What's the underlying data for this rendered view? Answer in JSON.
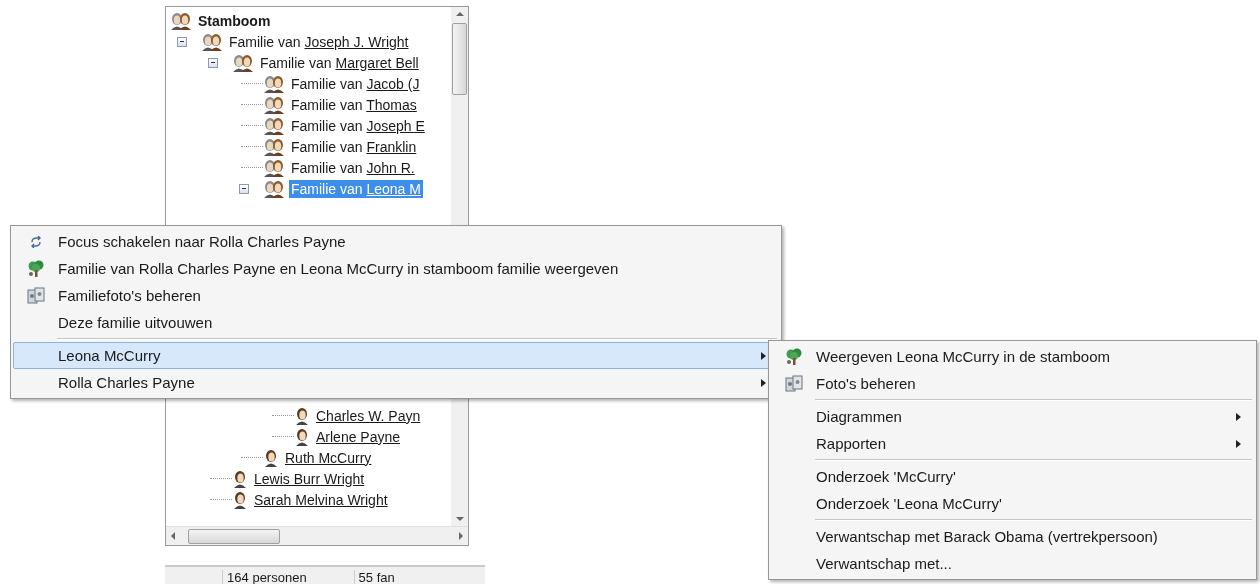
{
  "tree": {
    "nodes": [
      {
        "kind": "root",
        "label": "Stamboom",
        "selected": false,
        "children": [
          {
            "kind": "family",
            "prefix": "Familie van ",
            "name": "Joseph J. Wright",
            "selected": false,
            "children": [
              {
                "kind": "family",
                "prefix": "Familie van ",
                "name": "Margaret Bell",
                "selected": false,
                "children": [
                  {
                    "kind": "family",
                    "prefix": "Familie van ",
                    "name": "Jacob (J",
                    "selected": false
                  },
                  {
                    "kind": "family",
                    "prefix": "Familie van ",
                    "name": "Thomas",
                    "selected": false
                  },
                  {
                    "kind": "family",
                    "prefix": "Familie van ",
                    "name": "Joseph E",
                    "selected": false
                  },
                  {
                    "kind": "family",
                    "prefix": "Familie van ",
                    "name": "Franklin",
                    "selected": false
                  },
                  {
                    "kind": "family",
                    "prefix": "Familie van ",
                    "name": "John R.",
                    "selected": false
                  },
                  {
                    "kind": "family",
                    "prefix": "Familie van ",
                    "name": "Leona M",
                    "selected": true,
                    "children": [
                      {
                        "kind": "person",
                        "name": "Charles W. Payn",
                        "selected": false
                      },
                      {
                        "kind": "person",
                        "name": "Arlene Payne",
                        "selected": false
                      }
                    ]
                  },
                  {
                    "kind": "person",
                    "name": "Ruth McCurry",
                    "selected": false
                  }
                ]
              },
              {
                "kind": "person",
                "name": "Lewis Burr Wright",
                "selected": false
              },
              {
                "kind": "person",
                "name": "Sarah Melvina Wright",
                "selected": false
              }
            ]
          }
        ]
      }
    ]
  },
  "status_bar": [
    "164 personen",
    "55 fan"
  ],
  "context_menu": {
    "groups": [
      [
        {
          "kind": "switch",
          "label": "Focus schakelen naar Rolla Charles Payne",
          "selected": false,
          "submenu": false
        },
        {
          "kind": "tree",
          "label": "Familie van Rolla Charles Payne en Leona McCurry in stamboom familie weergeven",
          "selected": false,
          "submenu": false
        },
        {
          "kind": "photos",
          "label": "Familiefoto's beheren",
          "selected": false,
          "submenu": false
        },
        {
          "kind": "plain",
          "label": "Deze familie uitvouwen",
          "selected": false,
          "submenu": false
        }
      ],
      [
        {
          "kind": "plain",
          "label": "Leona McCurry",
          "selected": true,
          "submenu": true
        },
        {
          "kind": "plain",
          "label": "Rolla Charles Payne",
          "selected": false,
          "submenu": true
        }
      ]
    ]
  },
  "submenu": {
    "groups": [
      [
        {
          "kind": "tree",
          "label": "Weergeven Leona McCurry in de stamboom",
          "selected": false,
          "submenu": false
        },
        {
          "kind": "photos",
          "label": "Foto's beheren",
          "selected": false,
          "submenu": false
        }
      ],
      [
        {
          "kind": "plain",
          "label": "Diagrammen",
          "selected": false,
          "submenu": true
        },
        {
          "kind": "plain",
          "label": "Rapporten",
          "selected": false,
          "submenu": true
        }
      ],
      [
        {
          "kind": "plain",
          "label": "Onderzoek 'McCurry'",
          "selected": false,
          "submenu": false
        },
        {
          "kind": "plain",
          "label": "Onderzoek 'Leona McCurry'",
          "selected": false,
          "submenu": false
        }
      ],
      [
        {
          "kind": "plain",
          "label": "Verwantschap met Barack Obama (vertrekpersoon)",
          "selected": false,
          "submenu": false
        },
        {
          "kind": "plain",
          "label": "Verwantschap met...",
          "selected": false,
          "submenu": false
        }
      ]
    ]
  }
}
